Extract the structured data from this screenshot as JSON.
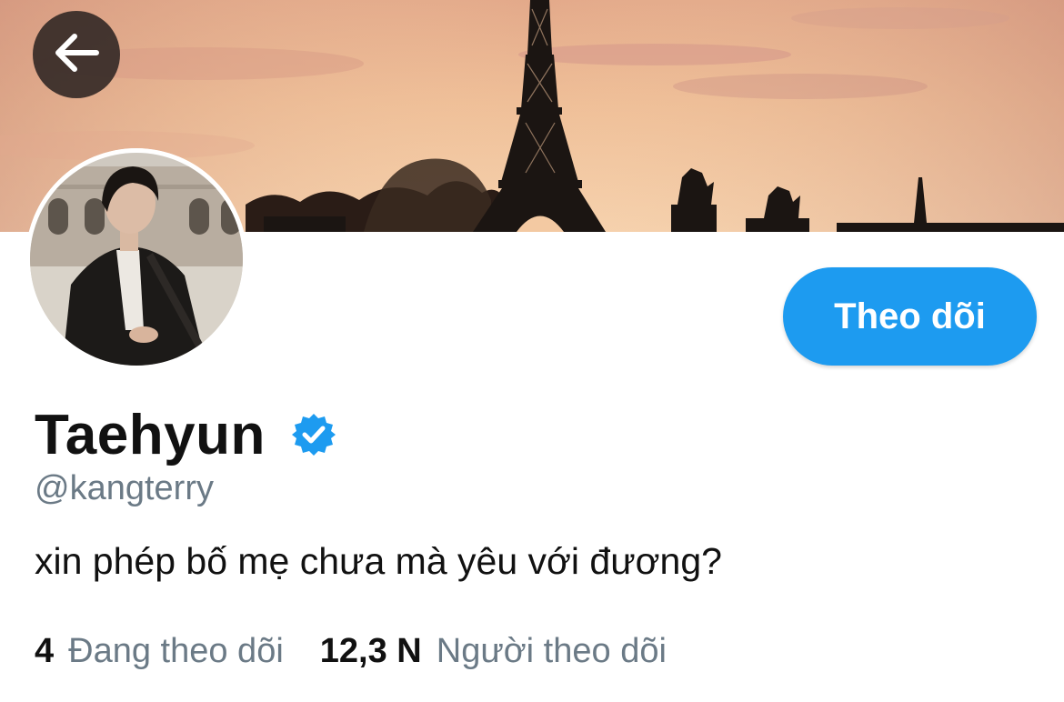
{
  "header": {
    "back_icon": "arrow-left-icon",
    "banner_description_colors": {
      "sky_top": "#e9b48a",
      "sky_bottom": "#f3c9a2",
      "silhouette": "#1b1512"
    }
  },
  "profile": {
    "display_name": "Taehyun",
    "verified": true,
    "verified_icon": "verified-badge-icon",
    "handle": "@kangterry",
    "bio": "xin phép bố mẹ chưa mà yêu với đương?",
    "follow_button_label": "Theo dõi"
  },
  "stats": {
    "following_count": "4",
    "following_label": "Đang theo dõi",
    "followers_count": "12,3 N",
    "followers_label": "Người theo dõi"
  },
  "colors": {
    "accent": "#1d9bf0",
    "secondary_text": "#6b7a86",
    "primary_text": "#111111"
  }
}
